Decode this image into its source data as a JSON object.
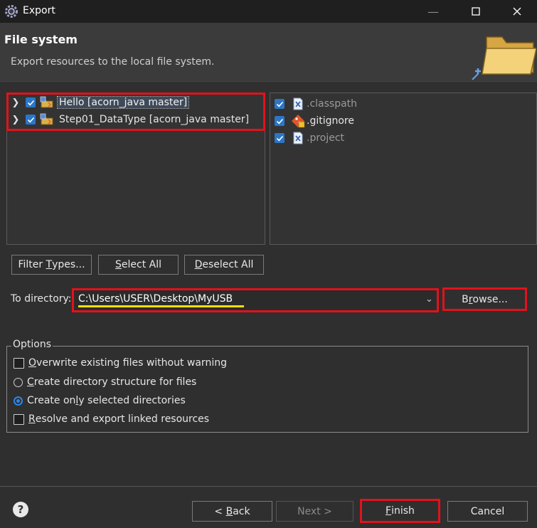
{
  "window": {
    "title": "Export"
  },
  "header": {
    "title": "File system",
    "description": "Export resources to the local file system."
  },
  "projects": [
    {
      "label": "Hello [acorn_java master]",
      "checked": true,
      "selected": true
    },
    {
      "label": "Step01_DataType [acorn_java master]",
      "checked": true,
      "selected": false
    }
  ],
  "files": [
    {
      "label": ".classpath",
      "checked": true,
      "icon": "xml-file-icon",
      "color": "#9a9a9a"
    },
    {
      "label": ".gitignore",
      "checked": true,
      "icon": "git-file-icon",
      "color": "#e6e6e6"
    },
    {
      "label": ".project",
      "checked": true,
      "icon": "xml-file-icon",
      "color": "#9a9a9a"
    }
  ],
  "selection_buttons": {
    "filter_prefix": "Filter ",
    "filter_u": "T",
    "filter_suffix": "ypes...",
    "select_all_u": "S",
    "select_all_rest": "elect All",
    "deselect_all_u": "D",
    "deselect_all_rest": "eselect All"
  },
  "destination": {
    "label": "To directory:",
    "path": "C:\\Users\\USER\\Desktop\\MyUSB",
    "browse_prefix": "B",
    "browse_u": "r",
    "browse_suffix": "owse..."
  },
  "options": {
    "legend": "Options",
    "overwrite": {
      "u": "O",
      "rest": "verwrite existing files without warning",
      "checked": false
    },
    "create_structure": {
      "u": "C",
      "rest": "reate directory structure for files",
      "selected": false
    },
    "create_selected": {
      "prefix": "Create on",
      "u": "l",
      "rest": "y selected directories",
      "selected": true
    },
    "linked": {
      "u": "R",
      "rest": "esolve and export linked resources",
      "checked": false
    }
  },
  "footer": {
    "back_prefix": "< ",
    "back_u": "B",
    "back_rest": "ack",
    "next": "Next >",
    "finish_u": "F",
    "finish_rest": "inish",
    "cancel": "Cancel"
  },
  "colors": {
    "accent": "#2b76c9",
    "highlight": "#e2121b",
    "underline": "#f0e000"
  }
}
